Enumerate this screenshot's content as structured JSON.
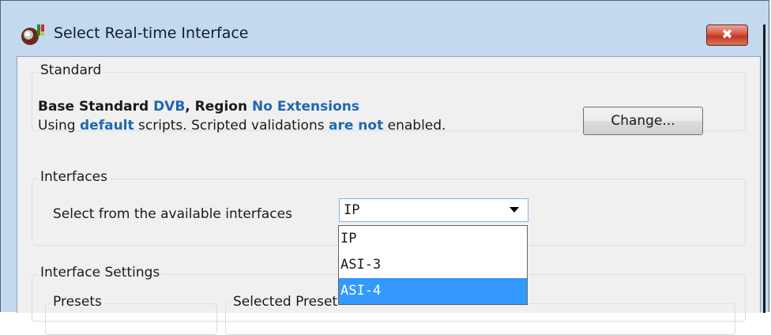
{
  "window": {
    "title": "Select Real-time Interface",
    "close_label": "✖"
  },
  "standard": {
    "group_label": "Standard",
    "base_prefix": "Base Standard",
    "base_value": "DVB",
    "region_prefix": ", Region",
    "region_value": "No Extensions",
    "scripts_prefix": "Using",
    "scripts_value": "default",
    "scripts_middle": "scripts. Scripted validations",
    "validation_value": "are not",
    "scripts_suffix": "enabled.",
    "change_label": "Change..."
  },
  "interfaces": {
    "group_label": "Interfaces",
    "select_label": "Select from the available interfaces",
    "selected_value": "IP",
    "options": [
      "IP",
      "ASI-3",
      "ASI-4"
    ],
    "highlighted_index": 2
  },
  "interface_settings": {
    "group_label": "Interface Settings",
    "presets_label": "Presets",
    "selected_preset_label": "Selected Preset"
  },
  "colors": {
    "accent": "#2068b0",
    "selection": "#3399ff",
    "titlebar": "#c3d9ee",
    "close": "#c1371f"
  }
}
